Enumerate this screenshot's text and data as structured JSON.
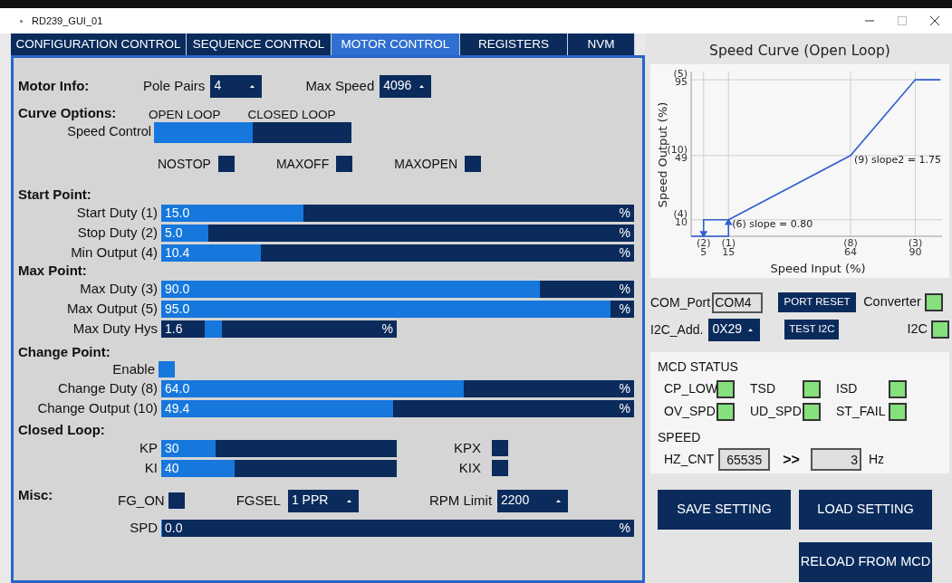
{
  "window": {
    "title": "RD239_GUI_01"
  },
  "tabs": [
    {
      "label": "CONFIGURATION CONTROL",
      "selected": false
    },
    {
      "label": "SEQUENCE CONTROL",
      "selected": false
    },
    {
      "label": "MOTOR CONTROL",
      "selected": true
    },
    {
      "label": "REGISTERS",
      "selected": false
    },
    {
      "label": "NVM",
      "selected": false
    }
  ],
  "motor_info": {
    "title": "Motor Info:",
    "fields": [
      {
        "label": "Pole Pairs",
        "value": "4"
      },
      {
        "label": "Max Speed",
        "value": "4096"
      }
    ]
  },
  "curve_options": {
    "title": "Curve Options:",
    "control_label": "Speed Control",
    "modes": [
      {
        "label": "OPEN LOOP",
        "selected": true
      },
      {
        "label": "CLOSED LOOP",
        "selected": false
      }
    ],
    "flags": [
      {
        "label": "NOSTOP",
        "checked": false
      },
      {
        "label": "MAXOFF",
        "checked": false
      },
      {
        "label": "MAXOPEN",
        "checked": false
      }
    ]
  },
  "start_point": {
    "title": "Start Point:",
    "rows": [
      {
        "label": "Start Duty (1)",
        "value": "15.0",
        "level": 0.3,
        "unit": "%",
        "kind": "full"
      },
      {
        "label": "Stop Duty (2)",
        "value": "5.0",
        "level": 0.1,
        "unit": "%",
        "kind": "full"
      },
      {
        "label": "Min Output (4)",
        "value": "10.4",
        "level": 0.21,
        "unit": "%",
        "kind": "full"
      }
    ]
  },
  "max_point": {
    "title": "Max Point:",
    "rows": [
      {
        "label": "Max Duty (3)",
        "value": "90.0",
        "level": 0.8,
        "unit": "%",
        "kind": "full"
      },
      {
        "label": "Max Output (5)",
        "value": "95.0",
        "level": 0.95,
        "unit": "%",
        "kind": "full"
      },
      {
        "label": "Max Duty Hys",
        "value": "1.6",
        "level": 0.09,
        "unit": "%",
        "kind": "short"
      }
    ]
  },
  "change_point": {
    "title": "Change Point:",
    "enable": {
      "label": "Enable",
      "checked": true
    },
    "rows": [
      {
        "label": "Change Duty (8)",
        "value": "64.0",
        "level": 0.64,
        "unit": "%",
        "kind": "full"
      },
      {
        "label": "Change Output (10)",
        "value": "49.4",
        "level": 0.49,
        "unit": "%",
        "kind": "full"
      }
    ]
  },
  "closed_loop": {
    "title": "Closed Loop:",
    "rows": [
      {
        "label": "KP",
        "value": "30",
        "level": 0.23,
        "flag": {
          "label": "KPX",
          "checked": false
        }
      },
      {
        "label": "KI",
        "value": "40",
        "level": 0.31,
        "flag": {
          "label": "KIX",
          "checked": false
        }
      }
    ]
  },
  "misc": {
    "title": "Misc:",
    "fg_on": {
      "label": "FG_ON",
      "checked": false
    },
    "fgsel": {
      "label": "FGSEL",
      "value": "1 PPR"
    },
    "rpm_limit": {
      "label": "RPM Limit",
      "value": "2200"
    },
    "spd": {
      "label": "SPD",
      "value": "0.0",
      "level": 0,
      "unit": "%"
    }
  },
  "speed_curve": {
    "chart_data": {
      "type": "line",
      "title": "Speed Curve (Open Loop)",
      "xlabel": "Speed Input (%)",
      "ylabel": "Speed Output (%)",
      "x": [
        15,
        64,
        90,
        100
      ],
      "series": [
        {
          "color": "#2f5fd0",
          "values": [
            10,
            49,
            95,
            95
          ]
        }
      ],
      "xlim": [
        0,
        100
      ],
      "ylim": [
        0,
        100
      ],
      "grid": true,
      "xticks": [
        5,
        15,
        64,
        90
      ],
      "yticks": [
        95,
        49,
        10
      ],
      "annotations": [
        {
          "x": 15,
          "y": 10,
          "text": "(6) slope = 0.80"
        },
        {
          "x": 64,
          "y": 49,
          "text": "(9) slope2 = 1.75"
        }
      ]
    },
    "x_tick_refs": [
      "(2)",
      "(1)",
      "(8)",
      "(3)"
    ],
    "y_tick_refs": [
      "(5)",
      "(10)",
      "(4)"
    ]
  },
  "connection": {
    "com_port": {
      "label": "COM_Port",
      "value": "COM4"
    },
    "port_reset": "PORT RESET",
    "converter": {
      "label": "Converter",
      "on": true
    },
    "i2c_address": {
      "label": "I2C_Add.",
      "value": "0X29"
    },
    "test_i2c": "TEST I2C",
    "i2c": {
      "label": "I2C",
      "on": true
    }
  },
  "mcd_status": {
    "title": "MCD STATUS",
    "indicators": [
      {
        "label": "CP_LOW",
        "on": true
      },
      {
        "label": "TSD",
        "on": true
      },
      {
        "label": "ISD",
        "on": true
      },
      {
        "label": "OV_SPD",
        "on": true
      },
      {
        "label": "UD_SPD",
        "on": true
      },
      {
        "label": "ST_FAIL",
        "on": true
      }
    ],
    "speed_title": "SPEED",
    "hz_cnt": {
      "label": "HZ_CNT",
      "value": "65535"
    },
    "arrow": ">>",
    "frequency": {
      "value": "3",
      "unit": "Hz"
    }
  },
  "buttons": [
    "SAVE SETTING",
    "LOAD SETTING",
    "RELOAD FROM MCD"
  ]
}
